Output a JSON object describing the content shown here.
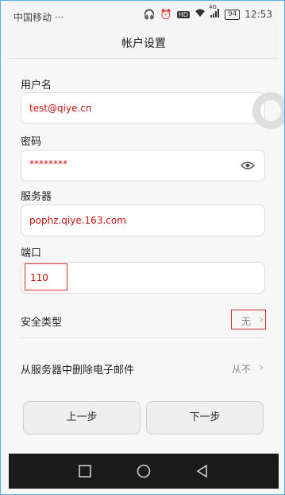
{
  "status_bar": {
    "carrier": "中国移动 ···",
    "battery": "94",
    "time": "12:53",
    "hd": "HD",
    "network": "4G"
  },
  "header": {
    "title": "帐户设置"
  },
  "form": {
    "username": {
      "label": "用户名",
      "value": "test@qiye.cn"
    },
    "password": {
      "label": "密码",
      "value": "********"
    },
    "server": {
      "label": "服务器",
      "value": "pophz.qiye.163.com"
    },
    "port": {
      "label": "端口",
      "value": "110"
    }
  },
  "settings": {
    "security": {
      "label": "安全类型",
      "value": "无"
    },
    "delete": {
      "label": "从服务器中删除电子邮件",
      "value": "从不"
    }
  },
  "buttons": {
    "prev": "上一步",
    "next": "下一步"
  },
  "colors": {
    "highlight": "#d62a2a",
    "value_text": "#cc1111",
    "nav_bar": "#1a1a1a"
  }
}
